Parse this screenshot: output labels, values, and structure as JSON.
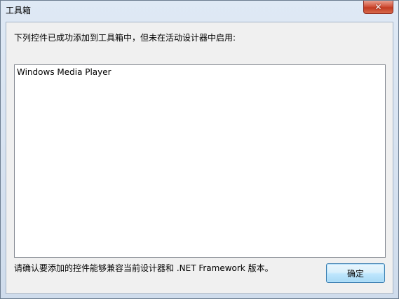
{
  "window": {
    "title": "工具箱"
  },
  "dialog": {
    "message": "下列控件已成功添加到工具箱中，但未在活动设计器中启用:",
    "list_items": [
      "Windows Media Player"
    ],
    "note": "请确认要添加的控件能够兼容当前设计器和 .NET Framework 版本。",
    "ok_label": "确定"
  },
  "icons": {
    "close": "close-icon"
  },
  "colors": {
    "close_button": "#c23b22",
    "frame": "#cfdcec",
    "ok_button_border": "#3c7fb1"
  }
}
